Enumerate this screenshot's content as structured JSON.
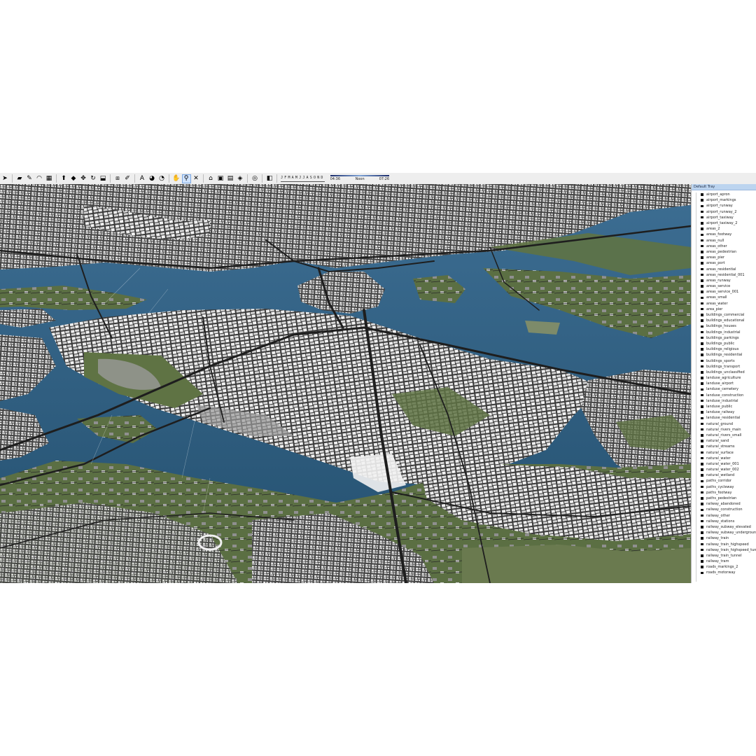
{
  "toolbar": {
    "tools": [
      {
        "icon": "select-arrow-icon",
        "glyph": "➤"
      },
      {
        "icon": "eraser-icon",
        "glyph": "▰"
      },
      {
        "icon": "pencil-line-icon",
        "glyph": "✎"
      },
      {
        "icon": "arc-icon",
        "glyph": "◠"
      },
      {
        "icon": "rectangle-icon",
        "glyph": "▦"
      },
      {
        "icon": "push-pull-icon",
        "glyph": "⬆"
      },
      {
        "icon": "follow-me-icon",
        "glyph": "◆"
      },
      {
        "icon": "move-icon",
        "glyph": "✥"
      },
      {
        "icon": "rotate-icon",
        "glyph": "↻"
      },
      {
        "icon": "scale-icon",
        "glyph": "⬓"
      },
      {
        "icon": "offset-icon",
        "glyph": "⧈"
      },
      {
        "icon": "tape-measure-icon",
        "glyph": "✐"
      },
      {
        "icon": "text-icon",
        "glyph": "A"
      },
      {
        "icon": "paint-bucket-icon",
        "glyph": "◕"
      },
      {
        "icon": "orbit-icon",
        "glyph": "◔"
      },
      {
        "icon": "pan-icon",
        "glyph": "✋"
      },
      {
        "icon": "zoom-icon",
        "glyph": "⚲"
      },
      {
        "icon": "zoom-extents-icon",
        "glyph": "✕"
      },
      {
        "icon": "warehouse-icon",
        "glyph": "⌂"
      },
      {
        "icon": "components-icon",
        "glyph": "▣"
      },
      {
        "icon": "extension-icon",
        "glyph": "▤"
      },
      {
        "icon": "ruby-icon",
        "glyph": "◈"
      },
      {
        "icon": "account-icon",
        "glyph": "◎"
      },
      {
        "icon": "shadows-toggle-icon",
        "glyph": "◧"
      }
    ],
    "shadow_months": [
      "J",
      "F",
      "M",
      "A",
      "M",
      "J",
      "J",
      "A",
      "S",
      "O",
      "N",
      "D"
    ],
    "time_start": "04:36",
    "time_mid": "Noon",
    "time_end": "07:26"
  },
  "tray": {
    "title": "Default Tray",
    "layers": [
      "airport_apron",
      "airport_markings",
      "airport_runway",
      "airport_runway_2",
      "airport_taxiway",
      "airport_taxiway_2",
      "areas_2",
      "areas_footway",
      "areas_null",
      "areas_other",
      "areas_pedestrian",
      "areas_pier",
      "areas_port",
      "areas_residential",
      "areas_residential_001",
      "areas_runway",
      "areas_service",
      "areas_service_001",
      "areas_small",
      "areas_water",
      "area_pier",
      "buildings_commercial",
      "buildings_educational",
      "buildings_houses",
      "buildings_industrial",
      "buildings_parkings",
      "buildings_public",
      "buildings_religious",
      "buildings_residential",
      "buildings_sports",
      "buildings_transport",
      "buildings_unclassified",
      "landuse_agriculture",
      "landuse_airport",
      "landuse_cemetery",
      "landuse_construction",
      "landuse_industrial",
      "landuse_public",
      "landuse_railway",
      "landuse_residential",
      "natural_ground",
      "natural_rivers_main",
      "natural_rivers_small",
      "natural_sand",
      "natural_streams",
      "natural_surface",
      "natural_water",
      "natural_water_001",
      "natural_water_002",
      "natural_wetland",
      "paths_corridor",
      "paths_cycleway",
      "paths_footway",
      "paths_pedestrian",
      "railway_abandoned",
      "railway_construction",
      "railway_other",
      "railway_stations",
      "railway_subway_elevated",
      "railway_subway_underground",
      "railway_train",
      "railway_train_highspeed",
      "railway_train_highspeed_tunnel",
      "railway_train_tunnel",
      "railway_tram",
      "roads_markings_2",
      "roads_motorway"
    ]
  },
  "viewport": {
    "scene": "3D city model aerial view",
    "colors": {
      "water": "#2f5a7c",
      "land": "#5f7344",
      "buildings": "#e8e8e8",
      "roads": "#2b2b2b",
      "plazas": "#9a9a9a"
    }
  }
}
